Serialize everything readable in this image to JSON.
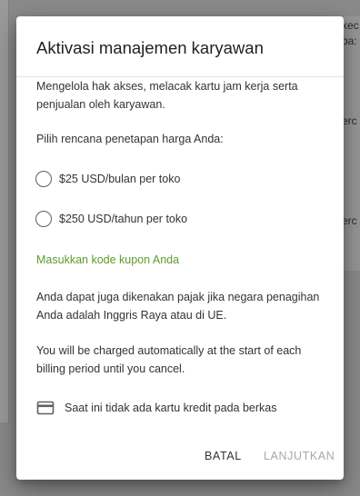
{
  "background": {
    "fragments": [
      "kec",
      "ba:",
      "erc",
      "erc"
    ]
  },
  "dialog": {
    "title": "Aktivasi manajemen karyawan",
    "description": "Mengelola hak akses, melacak kartu jam kerja serta penjualan oleh karyawan.",
    "pricing_prompt": "Pilih rencana penetapan harga Anda:",
    "plans": [
      {
        "label": "$25 USD/bulan per toko",
        "selected": false
      },
      {
        "label": "$250 USD/tahun per toko",
        "selected": false
      }
    ],
    "coupon_link": "Masukkan kode kupon Anda",
    "tax_note": "Anda dapat juga dikenakan pajak jika negara penagihan Anda adalah Inggris Raya atau di UE.",
    "charge_note": "You will be charged automatically at the start of each billing period until you cancel.",
    "card_status": {
      "icon": "credit-card-icon",
      "text": "Saat ini tidak ada kartu kredit pada berkas"
    },
    "buttons": {
      "cancel": "BATAL",
      "continue": "LANJUTKAN"
    }
  },
  "colors": {
    "link": "#5b9c2d",
    "disabled_button": "#a8a8a8"
  }
}
